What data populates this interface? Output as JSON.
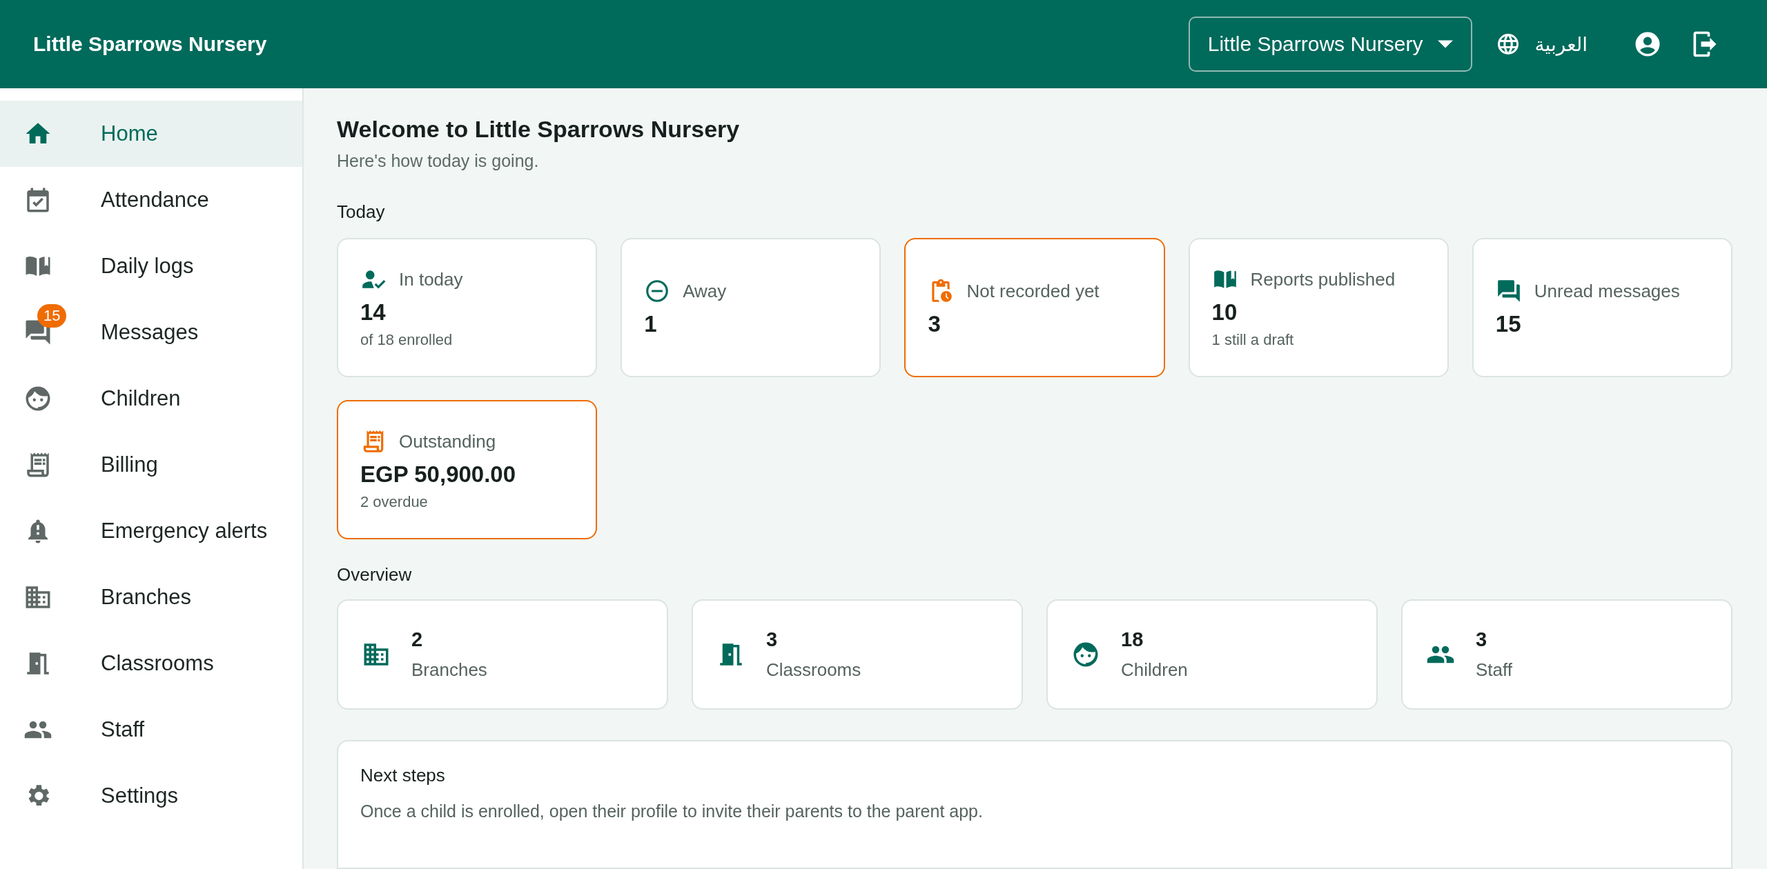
{
  "header": {
    "title": "Little Sparrows Nursery",
    "nursery_select": "Little Sparrows Nursery",
    "language": "العربية"
  },
  "sidebar": {
    "items": [
      {
        "label": "Home",
        "selected": true
      },
      {
        "label": "Attendance",
        "selected": false
      },
      {
        "label": "Daily logs",
        "selected": false
      },
      {
        "label": "Messages",
        "selected": false,
        "badge": "15"
      },
      {
        "label": "Children",
        "selected": false
      },
      {
        "label": "Billing",
        "selected": false
      },
      {
        "label": "Emergency alerts",
        "selected": false
      },
      {
        "label": "Branches",
        "selected": false
      },
      {
        "label": "Classrooms",
        "selected": false
      },
      {
        "label": "Staff",
        "selected": false
      },
      {
        "label": "Settings",
        "selected": false
      }
    ]
  },
  "welcome": {
    "title": "Welcome to Little Sparrows Nursery",
    "subtitle": "Here's how today is going."
  },
  "today": {
    "heading": "Today",
    "cards": [
      {
        "label": "In today",
        "value": "14",
        "note": "of 18 enrolled",
        "alert": false
      },
      {
        "label": "Away",
        "value": "1",
        "alert": false
      },
      {
        "label": "Not recorded yet",
        "value": "3",
        "alert": true
      },
      {
        "label": "Reports published",
        "value": "10",
        "note": "1 still a draft",
        "alert": false
      },
      {
        "label": "Unread messages",
        "value": "15",
        "alert": false
      },
      {
        "label": "Outstanding",
        "value": "EGP 50,900.00",
        "note": "2 overdue",
        "alert": true
      }
    ]
  },
  "overview": {
    "heading": "Overview",
    "cards": [
      {
        "value": "2",
        "label": "Branches"
      },
      {
        "value": "3",
        "label": "Classrooms"
      },
      {
        "value": "18",
        "label": "Children"
      },
      {
        "value": "3",
        "label": "Staff"
      }
    ]
  },
  "next_steps": {
    "title": "Next steps",
    "text": "Once a child is enrolled, open their profile to invite their parents to the parent app."
  }
}
